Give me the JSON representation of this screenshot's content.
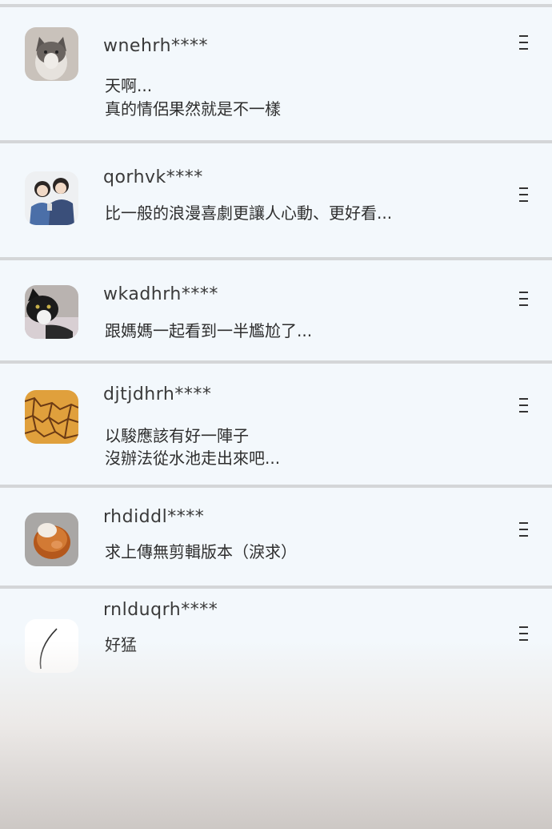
{
  "comments": [
    {
      "user": "wnehrh****",
      "lines": [
        "天啊...",
        "真的情侶果然就是不一樣"
      ],
      "avatar_icon": "cat-photo"
    },
    {
      "user": "qorhvk****",
      "lines": [
        "比一般的浪漫喜劇更讓人心動、更好看..."
      ],
      "avatar_icon": "couple-illustration"
    },
    {
      "user": "wkadhrh****",
      "lines": [
        "跟媽媽一起看到一半尷尬了..."
      ],
      "avatar_icon": "tuxedo-cat-photo"
    },
    {
      "user": "djtjdhrh****",
      "lines": [
        "以駿應該有好一陣子",
        "沒辦法從水池走出來吧..."
      ],
      "avatar_icon": "cracked-texture"
    },
    {
      "user": "rhdiddl****",
      "lines": [
        "求上傳無剪輯版本（淚求）"
      ],
      "avatar_icon": "bread-bun"
    },
    {
      "user": "rnlduqrh****",
      "lines": [
        "好猛"
      ],
      "avatar_icon": "feather-line"
    }
  ],
  "menu_icon": "more-menu-icon"
}
